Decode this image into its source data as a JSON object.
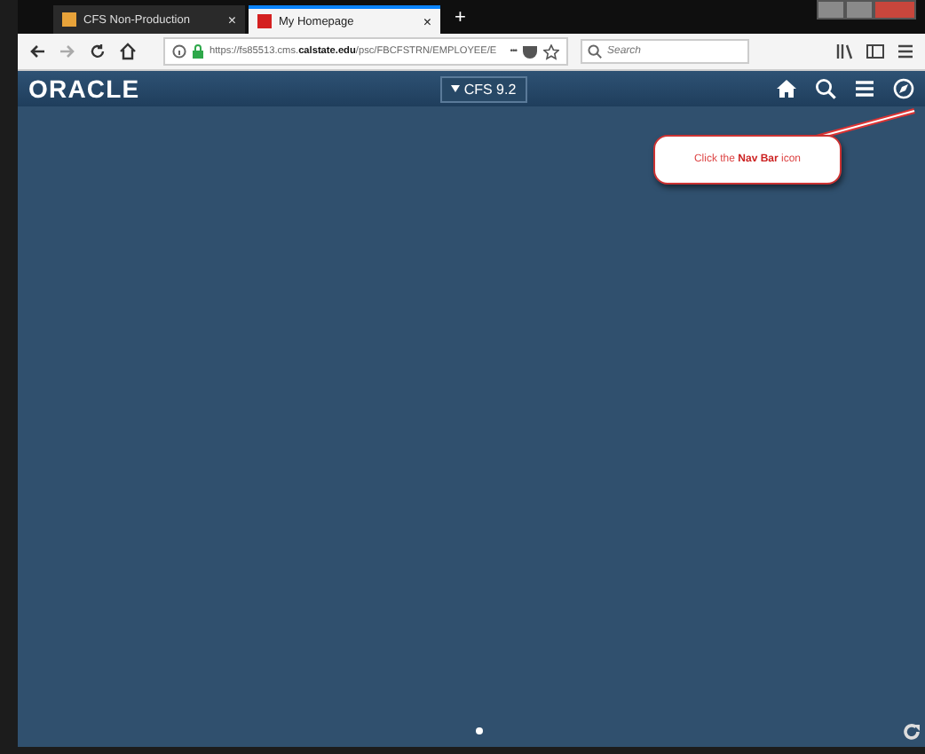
{
  "tabs": [
    {
      "title": "CFS Non-Production",
      "close": "×",
      "selected": false,
      "color": "#e8a33a"
    },
    {
      "title": "My Homepage",
      "close": "×",
      "selected": true,
      "color": "#d42020"
    }
  ],
  "new_tab": "+",
  "address_bar": {
    "url": "https://fs85513.cms.**calstate.edu**/psc/FBCFSTRN/EMPLOYEE/E",
    "more": "•••"
  },
  "search": {
    "placeholder": "Search"
  },
  "header": {
    "logo": "ORACLE",
    "menu": "CFS 9.2"
  },
  "callout": {
    "text": "Click the **Nav Bar** icon"
  }
}
